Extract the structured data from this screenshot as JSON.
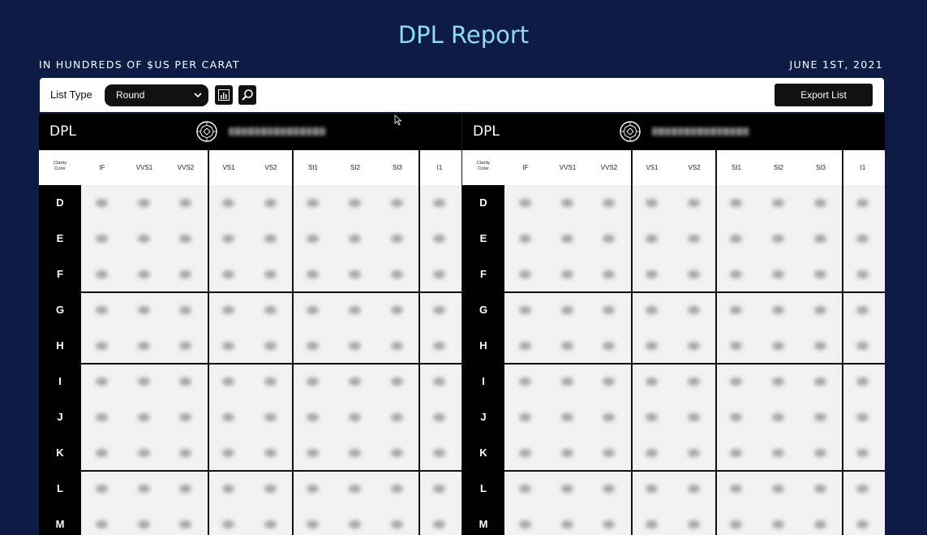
{
  "title": "DPL Report",
  "subtitle": "IN HUNDREDS OF $US PER CARAT",
  "date": "JUNE 1ST, 2021",
  "toolbar": {
    "list_type_label": "List Type",
    "list_type_value": "Round",
    "chart_icon": "bar-chart-icon",
    "search_icon": "search-icon",
    "export_label": "Export List"
  },
  "panels": [
    {
      "title": "DPL",
      "icon": "round-diamond-icon",
      "corner_label": [
        "Clarity",
        "Color"
      ],
      "clarity_columns": [
        "IF",
        "VVS1",
        "VVS2",
        "VS1",
        "VS2",
        "SI1",
        "SI2",
        "SI3",
        "I1"
      ],
      "color_rows": [
        "D",
        "E",
        "F",
        "G",
        "H",
        "I",
        "J",
        "K",
        "L",
        "M"
      ]
    },
    {
      "title": "DPL",
      "icon": "round-diamond-icon",
      "corner_label": [
        "Clarity",
        "Color"
      ],
      "clarity_columns": [
        "IF",
        "VVS1",
        "VVS2",
        "VS1",
        "VS2",
        "SI1",
        "SI2",
        "SI3",
        "I1"
      ],
      "color_rows": [
        "D",
        "E",
        "F",
        "G",
        "H",
        "I",
        "J",
        "K",
        "L",
        "M"
      ]
    }
  ]
}
